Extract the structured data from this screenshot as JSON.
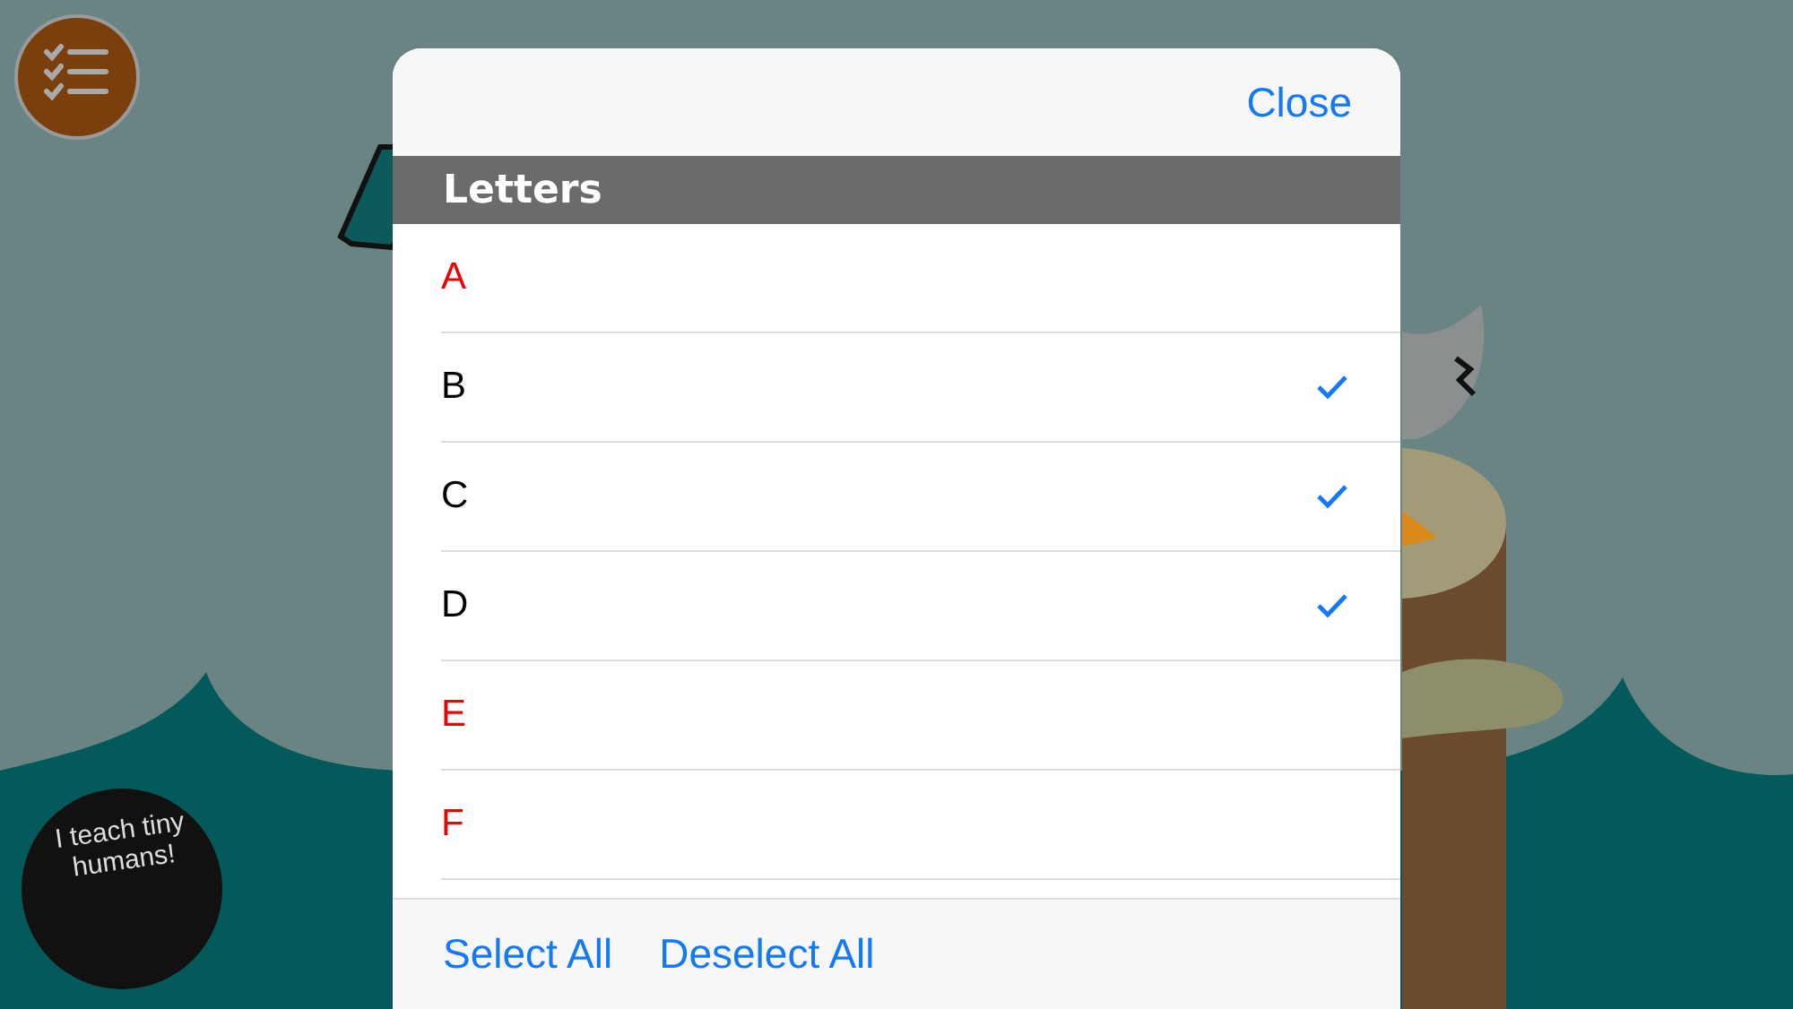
{
  "logo_text": "I teach tiny humans!",
  "modal": {
    "close": "Close",
    "section_title": "Letters",
    "letters": [
      {
        "label": "A",
        "checked": false
      },
      {
        "label": "B",
        "checked": true
      },
      {
        "label": "C",
        "checked": true
      },
      {
        "label": "D",
        "checked": true
      },
      {
        "label": "E",
        "checked": false
      },
      {
        "label": "F",
        "checked": false
      }
    ],
    "footer_buttons": [
      "Select All",
      "Deselect All"
    ]
  }
}
